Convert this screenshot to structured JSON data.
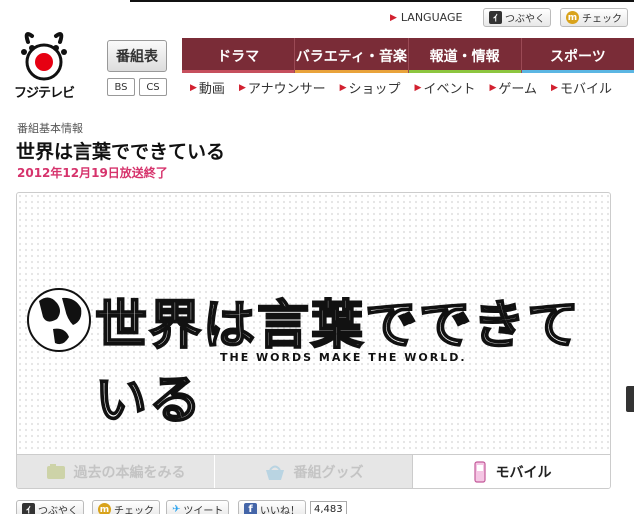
{
  "header": {
    "language": "LANGUAGE",
    "tsubuyaku": "つぶやく",
    "check": "チェック",
    "logo_text": "フジテレビ"
  },
  "program_button": "番組表",
  "bs": "BS",
  "cs": "CS",
  "main_nav": [
    {
      "label": "ドラマ",
      "underline": "#c64f5d"
    },
    {
      "label": "バラエティ・音楽",
      "underline": "#e9a33b"
    },
    {
      "label": "報道・情報",
      "underline": "#8dc63f"
    },
    {
      "label": "スポーツ",
      "underline": "#5bb6e3"
    }
  ],
  "sub_nav": [
    "動画",
    "アナウンサー",
    "ショップ",
    "イベント",
    "ゲーム",
    "モバイル"
  ],
  "breadcrumb": "番組基本情報",
  "title": "世界は言葉でできている",
  "ended": "2012年12月19日放送終了",
  "banner": {
    "title": "世界は言葉でできている",
    "tagline": "THE WORDS MAKE THE WORLD."
  },
  "tabs": [
    {
      "label": "過去の本編をみる",
      "icon": "video-icon",
      "active": false
    },
    {
      "label": "番組グッズ",
      "icon": "basket-icon",
      "active": false
    },
    {
      "label": "モバイル",
      "icon": "phone-icon",
      "active": true
    }
  ],
  "social": {
    "tsubuyaku": "つぶやく",
    "check": "チェック",
    "tweet": "ツイート",
    "like": "いいね！",
    "like_count": "4,483"
  },
  "colors": {
    "nav_bg": "#7a2c37",
    "accent_red": "#d2202f",
    "ended_pink": "#d6336c"
  }
}
